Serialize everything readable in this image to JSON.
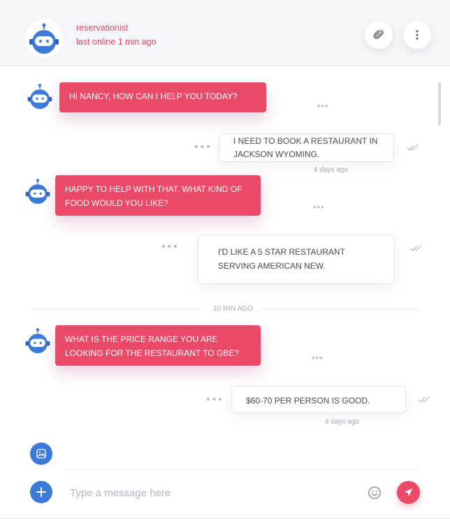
{
  "colors": {
    "accent": "#ea4a68",
    "primary_blue": "#3b7ad8",
    "header_bg": "#f5f6fa"
  },
  "header": {
    "name": "reservationist",
    "status": "last online 1 min ago",
    "attach_icon": "paperclip-icon",
    "more_icon": "kebab-menu-icon"
  },
  "messages": [
    {
      "from": "bot",
      "text": "Hi Nancy, how can I help you today?"
    },
    {
      "from": "user",
      "text": "I need to book a restaurant in Jackson Wyoming.",
      "time": "4 days ago"
    },
    {
      "from": "bot",
      "text": "Happy to help with that. What kind of food would you like?"
    },
    {
      "from": "user",
      "text": "I'd like a 5 star restaurant serving American New."
    },
    {
      "from": "bot",
      "text": "What is the price range you are looking for the restaurant to gbe?"
    },
    {
      "from": "user",
      "text": "$60-70 per person is good.",
      "time": "4 days ago"
    }
  ],
  "divider": "10 MIN AGO",
  "composer": {
    "placeholder": "Type a message here",
    "image_icon": "image-icon",
    "plus_icon": "plus-icon",
    "emoji_icon": "smiley-icon",
    "send_icon": "send-icon"
  }
}
